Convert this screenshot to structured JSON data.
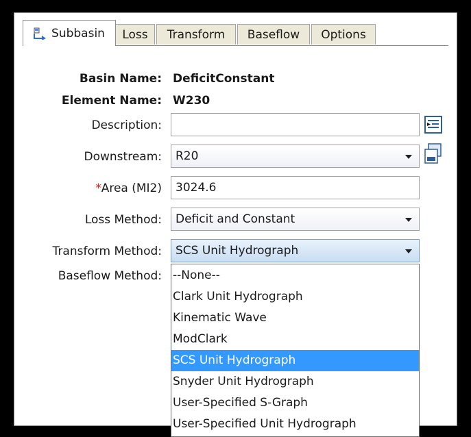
{
  "tabs": [
    {
      "label": "Subbasin",
      "icon": "subbasin-icon",
      "active": true
    },
    {
      "label": "Loss",
      "active": false
    },
    {
      "label": "Transform",
      "active": false
    },
    {
      "label": "Baseflow",
      "active": false
    },
    {
      "label": "Options",
      "active": false
    }
  ],
  "form": {
    "basin_name_label": "Basin Name:",
    "basin_name_value": "DeficitConstant",
    "element_name_label": "Element Name:",
    "element_name_value": "W230",
    "description_label": "Description:",
    "description_value": "",
    "downstream_label": "Downstream:",
    "downstream_value": "R20",
    "area_required_mark": "*",
    "area_label": "Area (MI2)",
    "area_value": "3024.6",
    "loss_method_label": "Loss Method:",
    "loss_method_value": "Deficit and Constant",
    "transform_method_label": "Transform Method:",
    "transform_method_value": "SCS Unit Hydrograph",
    "baseflow_method_label": "Baseflow Method:"
  },
  "transform_dropdown": {
    "options": [
      "--None--",
      "Clark Unit Hydrograph",
      "Kinematic Wave",
      "ModClark",
      "SCS Unit Hydrograph",
      "Snyder Unit Hydrograph",
      "User-Specified S-Graph",
      "User-Specified Unit Hydrograph"
    ],
    "selected": "SCS Unit Hydrograph"
  },
  "colors": {
    "selection": "#3399ff",
    "required": "#e02020"
  }
}
